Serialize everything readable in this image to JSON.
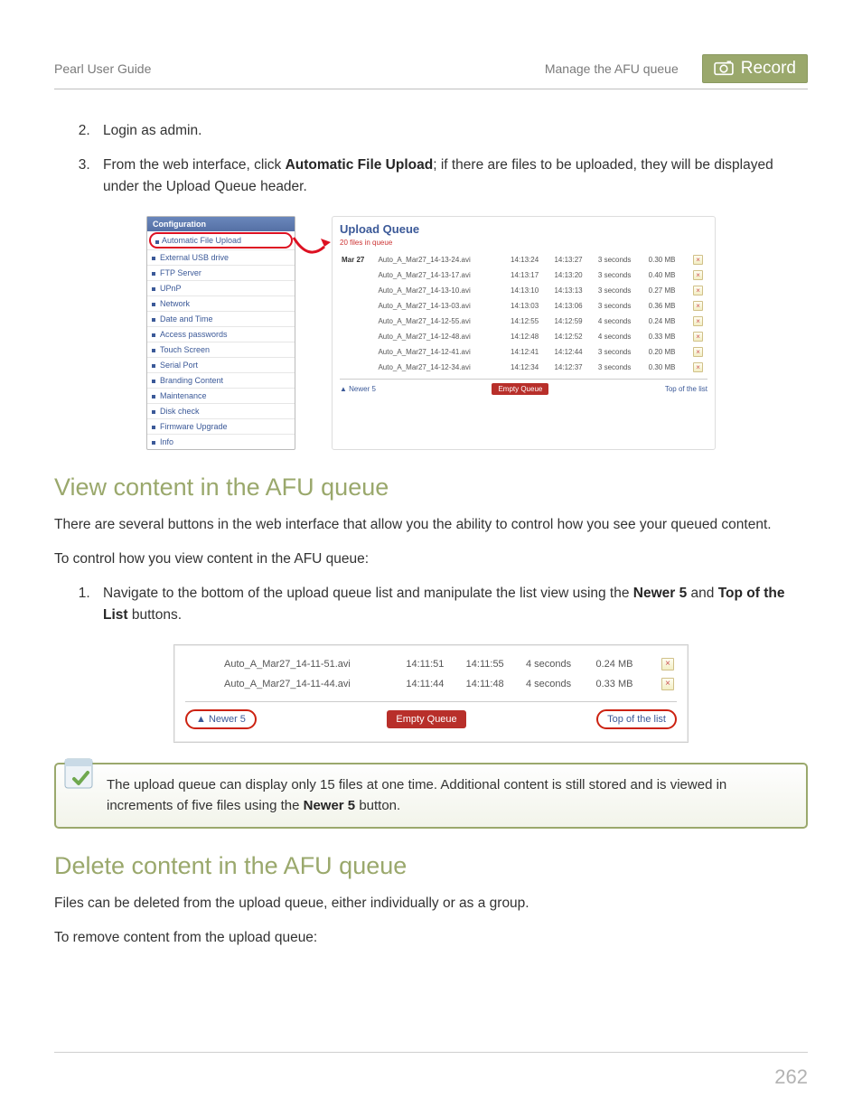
{
  "header": {
    "left": "Pearl User Guide",
    "center": "Manage the AFU queue",
    "badge_label": "Record"
  },
  "steps_top": [
    "Login as admin.",
    "From the web interface, click {b}Automatic File Upload{/b}; if there are files to be uploaded, they will be displayed under the Upload Queue header."
  ],
  "steps_start": 2,
  "fig1": {
    "sidebar_header": "Configuration",
    "sidebar_items": [
      "Automatic File Upload",
      "External USB drive",
      "FTP Server",
      "UPnP",
      "Network",
      "Date and Time",
      "Access passwords",
      "Touch Screen",
      "Serial Port",
      "Branding Content",
      "Maintenance",
      "Disk check",
      "Firmware Upgrade",
      "Info"
    ],
    "queue_title": "Upload Queue",
    "queue_sub": "20 files in queue",
    "date_label": "Mar 27",
    "rows": [
      {
        "f": "Auto_A_Mar27_14-13-24.avi",
        "a": "14:13:24",
        "b": "14:13:27",
        "d": "3 seconds",
        "s": "0.30 MB"
      },
      {
        "f": "Auto_A_Mar27_14-13-17.avi",
        "a": "14:13:17",
        "b": "14:13:20",
        "d": "3 seconds",
        "s": "0.40 MB"
      },
      {
        "f": "Auto_A_Mar27_14-13-10.avi",
        "a": "14:13:10",
        "b": "14:13:13",
        "d": "3 seconds",
        "s": "0.27 MB"
      },
      {
        "f": "Auto_A_Mar27_14-13-03.avi",
        "a": "14:13:03",
        "b": "14:13:06",
        "d": "3 seconds",
        "s": "0.36 MB"
      },
      {
        "f": "Auto_A_Mar27_14-12-55.avi",
        "a": "14:12:55",
        "b": "14:12:59",
        "d": "4 seconds",
        "s": "0.24 MB"
      },
      {
        "f": "Auto_A_Mar27_14-12-48.avi",
        "a": "14:12:48",
        "b": "14:12:52",
        "d": "4 seconds",
        "s": "0.33 MB"
      },
      {
        "f": "Auto_A_Mar27_14-12-41.avi",
        "a": "14:12:41",
        "b": "14:12:44",
        "d": "3 seconds",
        "s": "0.20 MB"
      },
      {
        "f": "Auto_A_Mar27_14-12-34.avi",
        "a": "14:12:34",
        "b": "14:12:37",
        "d": "3 seconds",
        "s": "0.30 MB"
      }
    ],
    "newer_label": "▲ Newer 5",
    "empty_label": "Empty Queue",
    "top_label": "Top of the list"
  },
  "h2_view": "View content in the AFU queue",
  "p_view_1": "There are several buttons in the web interface that allow you the ability to control how you see your queued content.",
  "p_view_2": "To control how you view content in the AFU queue:",
  "steps_view": [
    "Navigate to the bottom of the upload queue list and manipulate the list view using the {b}Newer 5{/b} and {b}Top of the List{/b} buttons."
  ],
  "fig2": {
    "rows": [
      {
        "f": "Auto_A_Mar27_14-11-51.avi",
        "a": "14:11:51",
        "b": "14:11:55",
        "d": "4 seconds",
        "s": "0.24 MB"
      },
      {
        "f": "Auto_A_Mar27_14-11-44.avi",
        "a": "14:11:44",
        "b": "14:11:48",
        "d": "4 seconds",
        "s": "0.33 MB"
      }
    ],
    "newer_label": "▲ Newer 5",
    "empty_label": "Empty Queue",
    "top_label": "Top of the list"
  },
  "callout": "The upload queue can display only 15 files at one time. Additional content is still stored and is viewed in increments of five files using the {b}Newer 5{/b} button.",
  "h2_delete": "Delete content in the AFU queue",
  "p_del_1": "Files can be deleted from the upload queue, either individually or as a group.",
  "p_del_2": "To remove content from the upload queue:",
  "page_number": "262"
}
